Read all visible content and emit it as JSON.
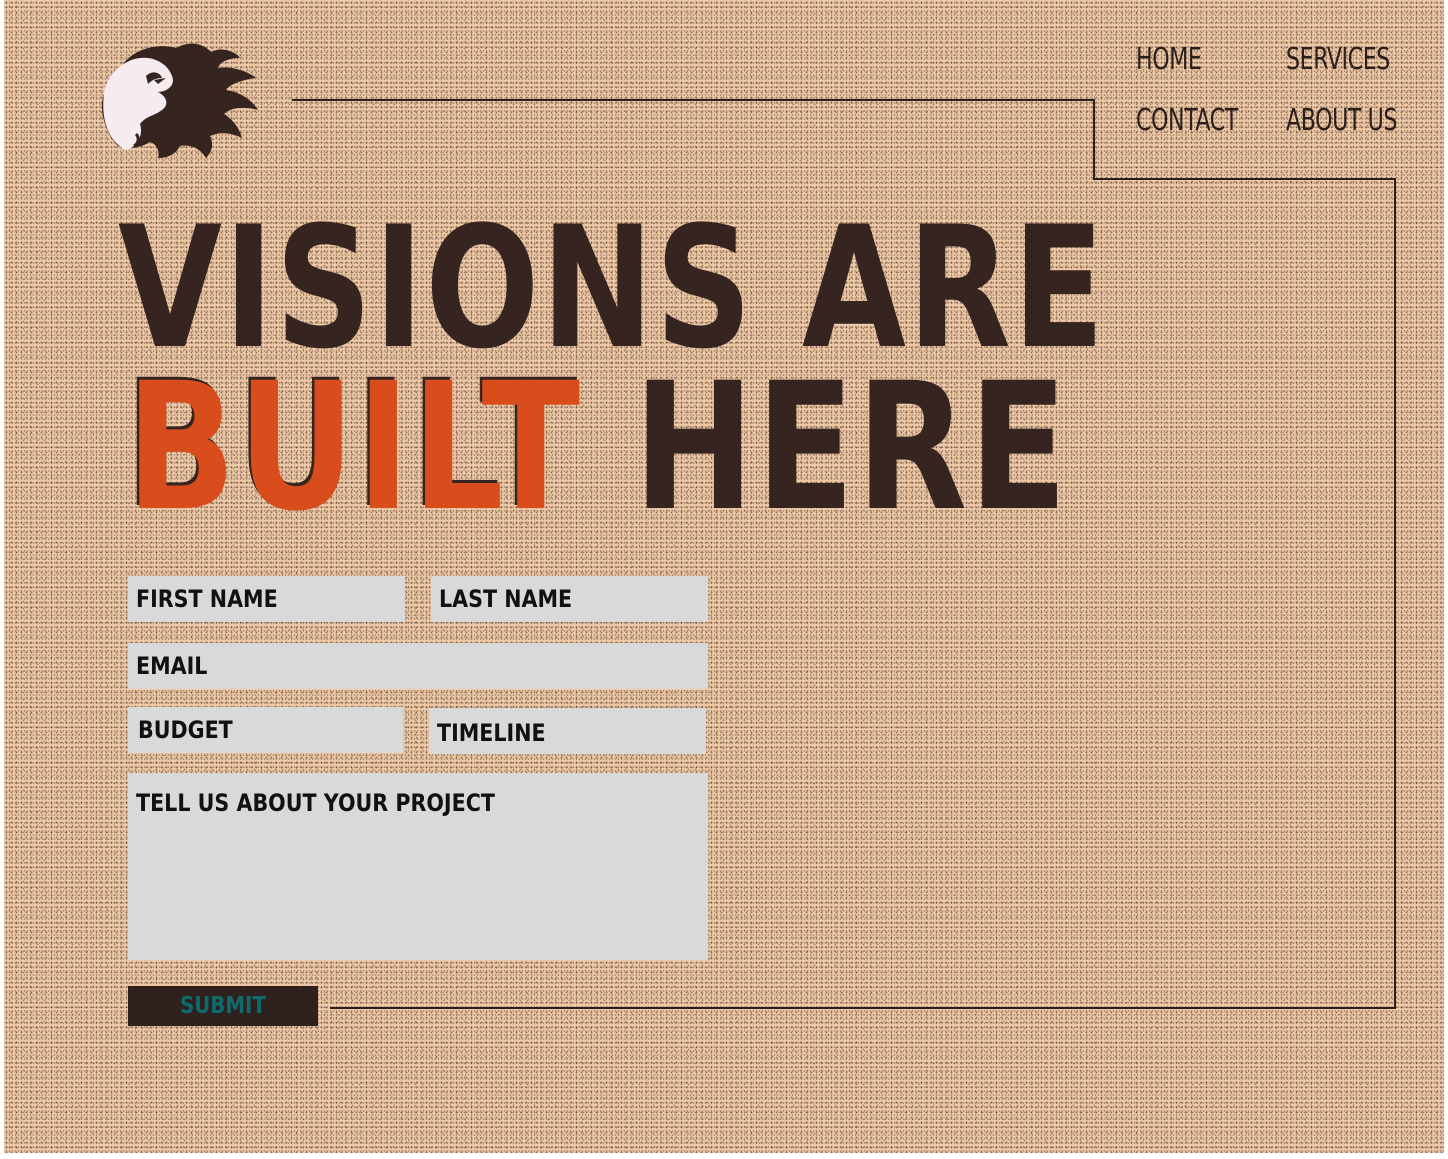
{
  "brand": {
    "logo_icon": "flaming-ghost-logo"
  },
  "nav": {
    "home": "HOME",
    "services": "SERVICES",
    "contact": "CONTACT",
    "about": "ABOUT US"
  },
  "hero": {
    "line1": "VISIONS ARE",
    "line2_accent": "BUILT",
    "line2_rest": "HERE"
  },
  "form": {
    "first_name": "FIRST NAME",
    "last_name": "LAST NAME",
    "email": "EMAIL",
    "budget": "BUDGET",
    "timeline": "TIMELINE",
    "project": "TELL US ABOUT YOUR PROJECT",
    "submit": "SUBMIT"
  },
  "colors": {
    "background": "#efc9a6",
    "dark_brown": "#352420",
    "accent_orange": "#d94c1c",
    "field_gray": "#d9d9d9",
    "submit_text_teal": "#0f6b6b"
  }
}
